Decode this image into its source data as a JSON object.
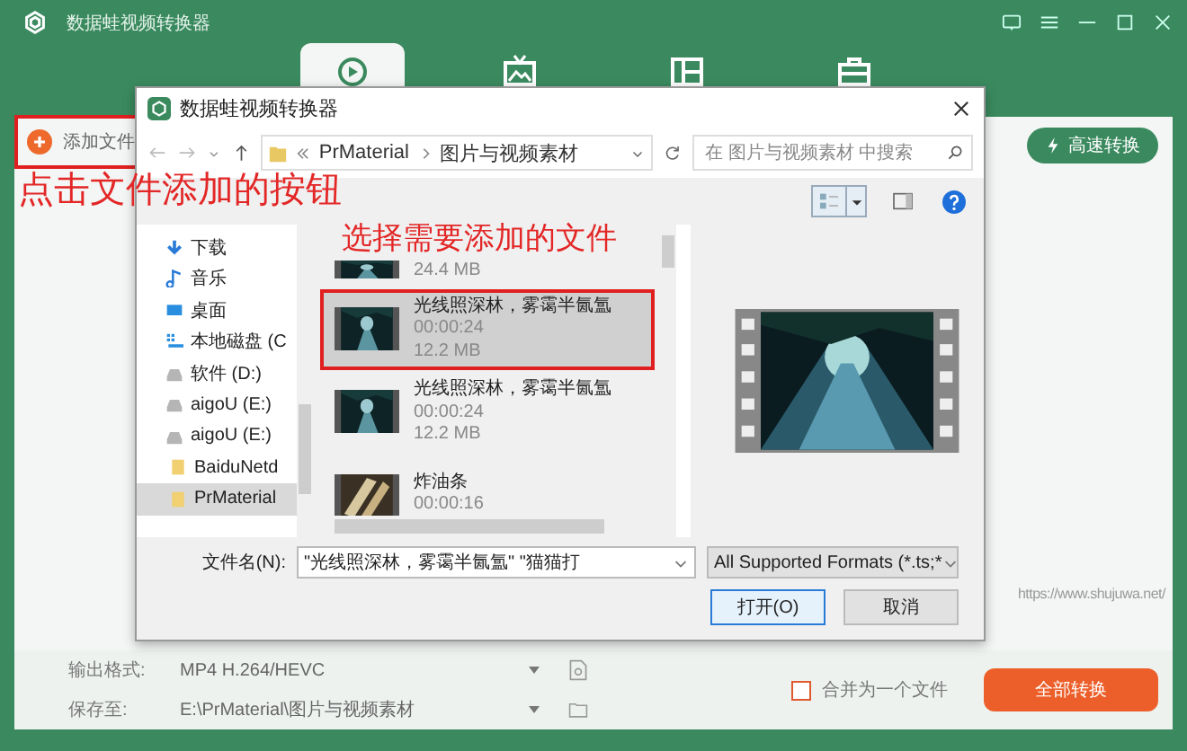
{
  "app": {
    "title": "数据蛙视频转换器",
    "tabs": [
      {
        "selected": true
      },
      {
        "selected": false
      },
      {
        "selected": false
      },
      {
        "selected": false
      }
    ],
    "add_file_button": "添加文件",
    "add_file_highlighted": true,
    "fast_convert_button": "高速转换",
    "website": "https://www.shujuwa.net/",
    "output_format": {
      "label": "输出格式:",
      "value": "MP4 H.264/HEVC"
    },
    "save_to": {
      "label": "保存至:",
      "value": "E:\\PrMaterial\\图片与视频素材"
    },
    "merge": {
      "label": "合并为一个文件",
      "checked": false
    },
    "convert_all_button": "全部转换"
  },
  "dialog": {
    "title": "数据蛙视频转换器",
    "breadcrumb": [
      "PrMaterial",
      "图片与视频素材"
    ],
    "search": {
      "placeholder": "在 图片与视频素材 中搜索"
    },
    "nav": [
      {
        "label": "下载",
        "kind": "download",
        "selected": false
      },
      {
        "label": "音乐",
        "kind": "music",
        "selected": false
      },
      {
        "label": "桌面",
        "kind": "desktop",
        "selected": false
      },
      {
        "label": "本地磁盘 (C",
        "kind": "system-drive",
        "selected": false
      },
      {
        "label": "软件 (D:)",
        "kind": "drive",
        "selected": false
      },
      {
        "label": "aigoU (E:)",
        "kind": "drive",
        "selected": false
      },
      {
        "label": "aigoU (E:)",
        "kind": "drive",
        "selected": false
      },
      {
        "label": "BaiduNetd",
        "kind": "folder",
        "selected": false
      },
      {
        "label": "PrMaterial",
        "kind": "folder",
        "selected": true
      }
    ],
    "files": [
      {
        "size": "24.4 MB",
        "selected": false,
        "highlighted": false,
        "kind": "partial"
      },
      {
        "name": "光线照深林，雾霭半氤氲",
        "duration": "00:00:24",
        "size": "12.2 MB",
        "selected": true,
        "highlighted": true,
        "kind": "full"
      },
      {
        "name": "光线照深林，雾霭半氤氲",
        "duration": "00:00:24",
        "size": "12.2 MB",
        "selected": false,
        "highlighted": false,
        "kind": "full"
      },
      {
        "name": "炸油条",
        "duration": "00:00:16",
        "selected": false,
        "highlighted": false,
        "kind": "food"
      }
    ],
    "file_name": {
      "label": "文件名(N):",
      "value": "\"光线照深林，雾霭半氤氲\" \"猫猫打"
    },
    "file_type": "All Supported Formats (*.ts;*",
    "open_button": "打开(O)",
    "cancel_button": "取消"
  },
  "annotations": [
    {
      "text": "点击文件添加的按钮"
    },
    {
      "text": "选择需要添加的文件"
    }
  ]
}
